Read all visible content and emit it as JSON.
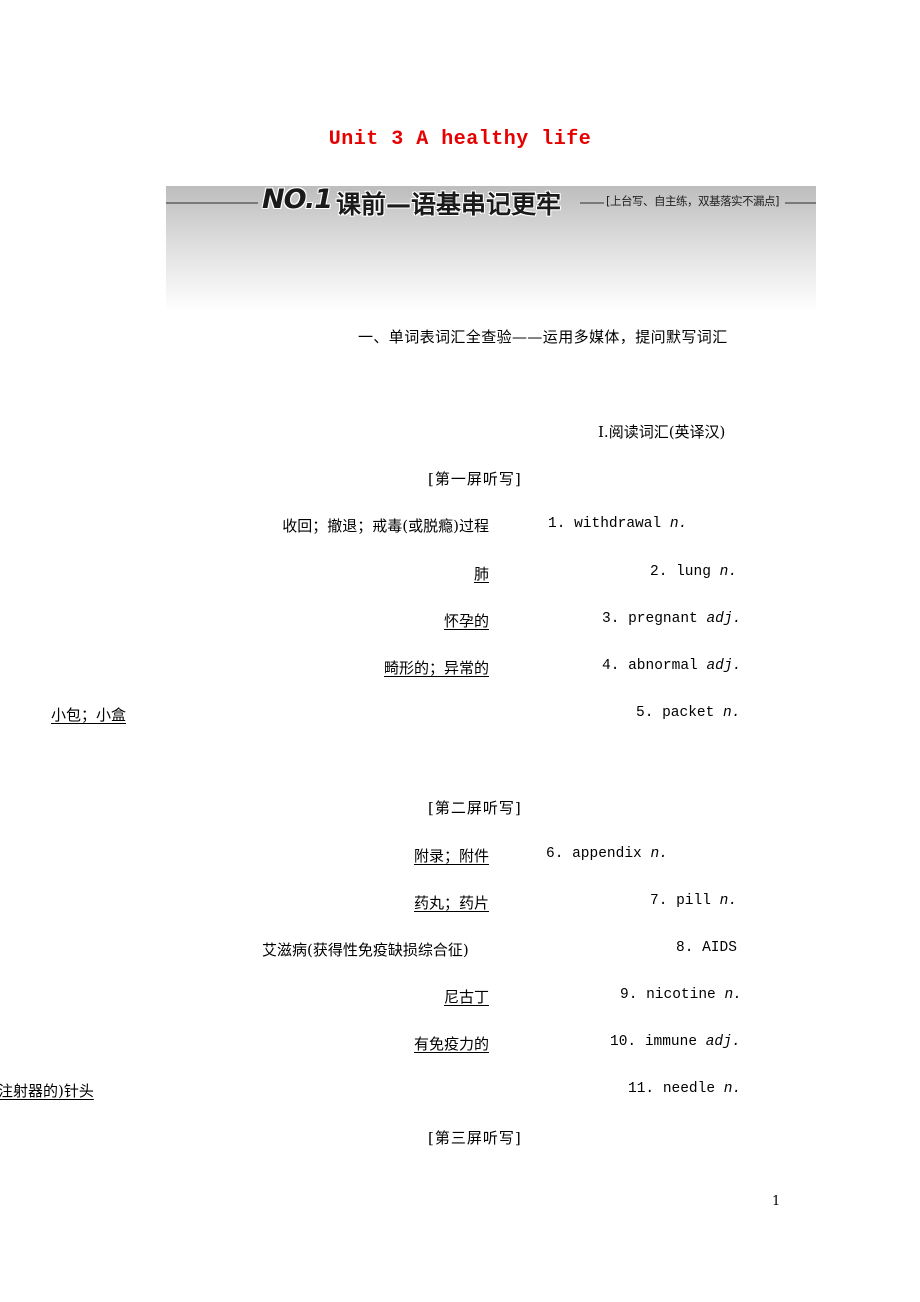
{
  "document": {
    "unit_title": "Unit 3  A healthy life",
    "title_color": "#e60000",
    "banner": {
      "number": "NO.1",
      "heading": "课前—语基串记更牢",
      "subheading": "[上台写、自主练，双基落实不漏点]"
    },
    "section_title": "一、单词表词汇全查验——运用多媒体，提问默写词汇",
    "sub_title": "Ⅰ.阅读词汇(英译汉)",
    "screens": [
      {
        "label": "[第一屏听写]",
        "items": [
          {
            "number": "1.",
            "word": "withdrawal",
            "pos": "n.",
            "meaning": "收回；撤退；戒毒(或脱瘾)过程",
            "underlined": false
          },
          {
            "number": "2.",
            "word": "lung",
            "pos": "n.",
            "meaning": "肺",
            "underlined": true
          },
          {
            "number": "3.",
            "word": "pregnant",
            "pos": "adj.",
            "meaning": "怀孕的",
            "underlined": true
          },
          {
            "number": "4.",
            "word": "abnormal",
            "pos": "adj.",
            "meaning": "畸形的；异常的",
            "underlined": true
          },
          {
            "number": "5.",
            "word": "packet",
            "pos": "n.",
            "meaning": "小包；小盒",
            "underlined": true
          }
        ]
      },
      {
        "label": "[第二屏听写]",
        "items": [
          {
            "number": "6.",
            "word": "appendix",
            "pos": "n.",
            "meaning": "附录；附件",
            "underlined": true
          },
          {
            "number": "7.",
            "word": "pill",
            "pos": "n.",
            "meaning": "药丸；药片",
            "underlined": true
          },
          {
            "number": "8.",
            "word": "AIDS",
            "pos": "",
            "meaning": "艾滋病(获得性免疫缺损综合征)",
            "underlined": false
          },
          {
            "number": "9.",
            "word": "nicotine",
            "pos": "n.",
            "meaning": "尼古丁",
            "underlined": true
          },
          {
            "number": "10.",
            "word": "immune",
            "pos": "adj.",
            "meaning": "有免疫力的",
            "underlined": true
          },
          {
            "number": "11.",
            "word": "needle",
            "pos": "n.",
            "meaning": "注射器的)针头",
            "underlined": true
          }
        ]
      },
      {
        "label": "[第三屏听写]",
        "items": []
      }
    ],
    "page_number": "1"
  }
}
